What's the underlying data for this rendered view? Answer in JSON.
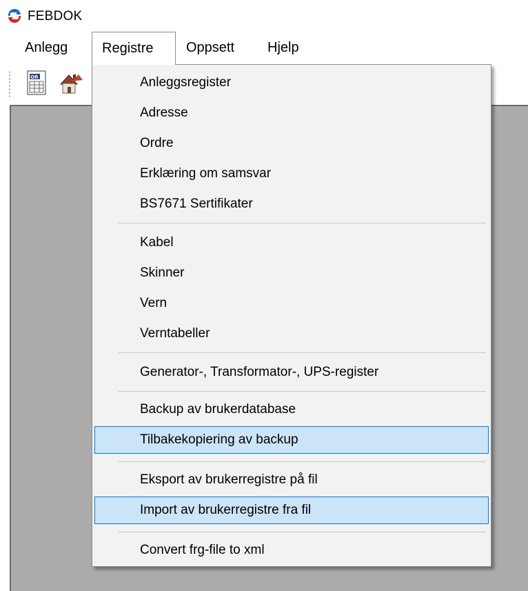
{
  "window": {
    "title": "FEBDOK",
    "logo_icon": "febdok-logo-icon"
  },
  "menubar": {
    "items": [
      {
        "label": "Anlegg"
      },
      {
        "label": "Registre"
      },
      {
        "label": "Oppsett"
      },
      {
        "label": "Hjelp"
      }
    ],
    "open_menu": "Registre"
  },
  "toolbar": {
    "buttons": [
      {
        "icon": "order-register-icon",
        "text": "OR"
      },
      {
        "icon": "facility-house-icon"
      }
    ]
  },
  "registre_menu": {
    "items": [
      {
        "label": "Anleggsregister"
      },
      {
        "label": "Adresse"
      },
      {
        "label": "Ordre"
      },
      {
        "label": "Erklæring om samsvar"
      },
      {
        "label": "BS7671 Sertifikater"
      },
      {
        "label": "Kabel"
      },
      {
        "label": "Skinner"
      },
      {
        "label": "Vern"
      },
      {
        "label": "Verntabeller"
      },
      {
        "label": "Generator-, Transformator-, UPS-register"
      },
      {
        "label": "Backup av brukerdatabase"
      },
      {
        "label": "Tilbakekopiering av backup",
        "highlighted": true
      },
      {
        "label": "Eksport av brukerregistre på fil"
      },
      {
        "label": "Import av brukerregistre fra fil",
        "highlighted": true
      },
      {
        "label": "Convert frg-file to xml"
      }
    ]
  },
  "colors": {
    "highlight_fill": "#cce4f7",
    "highlight_border": "#0078d7",
    "workspace": "#ababab",
    "menu_background": "#f2f2f2"
  }
}
